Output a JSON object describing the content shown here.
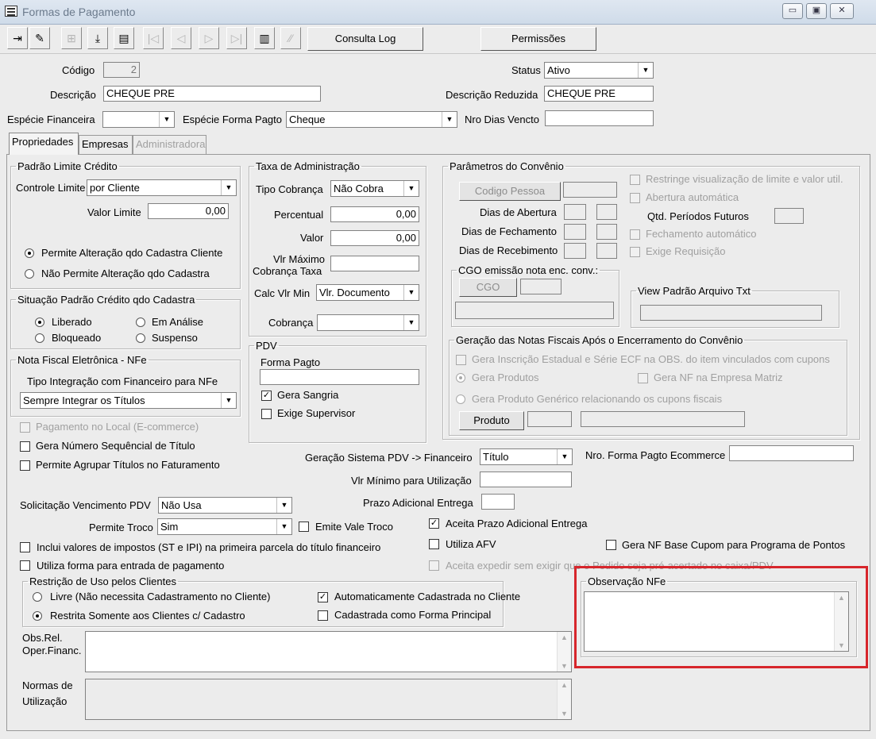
{
  "window": {
    "title": "Formas de Pagamento",
    "minimize": "▭",
    "maximize": "▣",
    "close": "✕"
  },
  "toolbar": {
    "buttons": [
      {
        "icon": "exit-icon",
        "glyph": "⇥"
      },
      {
        "icon": "edit-icon",
        "glyph": "✎"
      },
      {
        "icon": "grid-icon",
        "glyph": "⊞"
      },
      {
        "icon": "save-icon",
        "glyph": "⤓"
      },
      {
        "icon": "print-icon",
        "glyph": "▤"
      },
      {
        "icon": "first-icon",
        "glyph": "|◁"
      },
      {
        "icon": "prev-icon",
        "glyph": "◁"
      },
      {
        "icon": "next-icon",
        "glyph": "▷"
      },
      {
        "icon": "last-icon",
        "glyph": "▷|"
      },
      {
        "icon": "book-icon",
        "glyph": "▥"
      },
      {
        "icon": "toggle-icon",
        "glyph": "⁄⁄"
      }
    ],
    "consulta_log": "Consulta Log",
    "permissoes": "Permissões"
  },
  "header": {
    "codigo_label": "Código",
    "codigo_value": "2",
    "status_label": "Status",
    "status_value": "Ativo",
    "descricao_label": "Descrição",
    "descricao_value": "CHEQUE PRE",
    "descricao_reduzida_label": "Descrição Reduzida",
    "descricao_reduzida_value": "CHEQUE PRE",
    "especie_financeira_label": "Espécie Financeira",
    "especie_financeira_value": "",
    "especie_forma_pagto_label": "Espécie Forma Pagto",
    "especie_forma_pagto_value": "Cheque",
    "nro_dias_vencto_label": "Nro Dias Vencto",
    "nro_dias_vencto_value": ""
  },
  "tabs": [
    "Propriedades",
    "Empresas",
    "Administradora"
  ],
  "padrao_limite": {
    "title": "Padrão Limite Crédito",
    "controle_limite_label": "Controle Limite",
    "controle_limite_value": "por Cliente",
    "valor_limite_label": "Valor Limite",
    "valor_limite_value": "0,00",
    "permite_alteracao": "Permite Alteração qdo Cadastra Cliente",
    "nao_permite_alteracao": "Não Permite Alteração qdo Cadastra"
  },
  "situacao": {
    "title": "Situação Padrão Crédito qdo Cadastra",
    "liberado": "Liberado",
    "em_analise": "Em Análise",
    "bloqueado": "Bloqueado",
    "suspenso": "Suspenso"
  },
  "nfe": {
    "title": "Nota Fiscal Eletrônica - NFe",
    "tipo_label": "Tipo Integração com Financeiro para NFe",
    "tipo_value": "Sempre Integrar os Títulos"
  },
  "checks_left": {
    "pagamento_local": "Pagamento no Local (E-commerce)",
    "gera_numero": "Gera Número Sequêncial de Título",
    "permite_agrupar": "Permite Agrupar Títulos no Faturamento"
  },
  "taxa": {
    "title": "Taxa de Administração",
    "tipo_cobranca_label": "Tipo Cobrança",
    "tipo_cobranca_value": "Não Cobra",
    "percentual_label": "Percentual",
    "percentual_value": "0,00",
    "valor_label": "Valor",
    "valor_value": "0,00",
    "vlr_maximo_label_1": "Vlr Máximo",
    "vlr_maximo_label_2": "Cobrança Taxa",
    "vlr_maximo_value": "",
    "calc_vlr_min_label": "Calc Vlr Min",
    "calc_vlr_min_value": "Vlr. Documento",
    "cobranca_label": "Cobrança",
    "cobranca_value": ""
  },
  "pdv": {
    "title": "PDV",
    "forma_pagto_label": "Forma Pagto",
    "forma_pagto_value": "",
    "gera_sangria": "Gera Sangria",
    "exige_supervisor": "Exige Supervisor"
  },
  "convenio": {
    "title": "Parâmetros do Convênio",
    "codigo_pessoa": "Codigo Pessoa",
    "dias_abertura": "Dias de Abertura",
    "dias_fechamento": "Dias de Fechamento",
    "dias_recebimento": "Dias de Recebimento",
    "restringe": "Restringe visualização de limite e valor util.",
    "abertura_automatica": "Abertura automática",
    "qtd_periodos": "Qtd. Períodos Futuros",
    "fechamento_automatico": "Fechamento automático",
    "exige_requisicao": "Exige Requisição",
    "cgo_title": "CGO emissão nota enc. conv.:",
    "cgo_button": "CGO",
    "view_padrao_title": "View Padrão Arquivo Txt"
  },
  "geracao_notas": {
    "title": "Geração das Notas Fiscais Após o Encerramento do Convênio",
    "gera_inscricao": "Gera Inscrição Estadual e Série ECF na OBS. do item vinculados com cupons",
    "gera_produtos": "Gera Produtos",
    "gera_nf_matriz": "Gera NF na Empresa Matriz",
    "gera_produto_generico": "Gera Produto Genérico relacionando os cupons fiscais",
    "produto_button": "Produto"
  },
  "middle": {
    "geracao_pdv_label": "Geração Sistema PDV -> Financeiro",
    "geracao_pdv_value": "Título",
    "nro_ecommerce_label": "Nro. Forma Pagto Ecommerce",
    "nro_ecommerce_value": "",
    "vlr_minimo_label": "Vlr Mínimo para Utilização",
    "vlr_minimo_value": "",
    "prazo_adicional_label": "Prazo Adicional Entrega",
    "prazo_adicional_value": "",
    "solicitacao_label": "Solicitação Vencimento PDV",
    "solicitacao_value": "Não Usa",
    "permite_troco_label": "Permite Troco",
    "permite_troco_value": "Sim",
    "emite_vale_troco": "Emite Vale Troco",
    "aceita_prazo": "Aceita Prazo Adicional Entrega",
    "inclui_valores": "Inclui valores de impostos (ST e IPI) na primeira parcela do título financeiro",
    "utiliza_afv": "Utiliza AFV",
    "gera_nf_base": "Gera NF Base Cupom para Programa de Pontos",
    "utiliza_forma": "Utiliza forma para entrada de pagamento",
    "aceita_expedir": "Aceita expedir sem exigir que o Pedido seja pré-acertado no caixa/PDV"
  },
  "restricao": {
    "title": "Restrição de Uso pelos Clientes",
    "livre": "Livre (Não necessita Cadastramento no Cliente)",
    "restrita": "Restrita Somente aos Clientes c/ Cadastro",
    "auto_cadastrada": "Automaticamente Cadastrada no Cliente",
    "forma_principal": "Cadastrada como Forma Principal"
  },
  "observacao": {
    "title": "Observação NFe",
    "value": ""
  },
  "obs_rel": {
    "label_1": "Obs.Rel.",
    "label_2": "Oper.Financ.",
    "value": ""
  },
  "normas": {
    "label_1": "Normas de",
    "label_2": "Utilização",
    "value": ""
  },
  "colors": {
    "highlight": "#d7262c",
    "background": "#ececec"
  }
}
